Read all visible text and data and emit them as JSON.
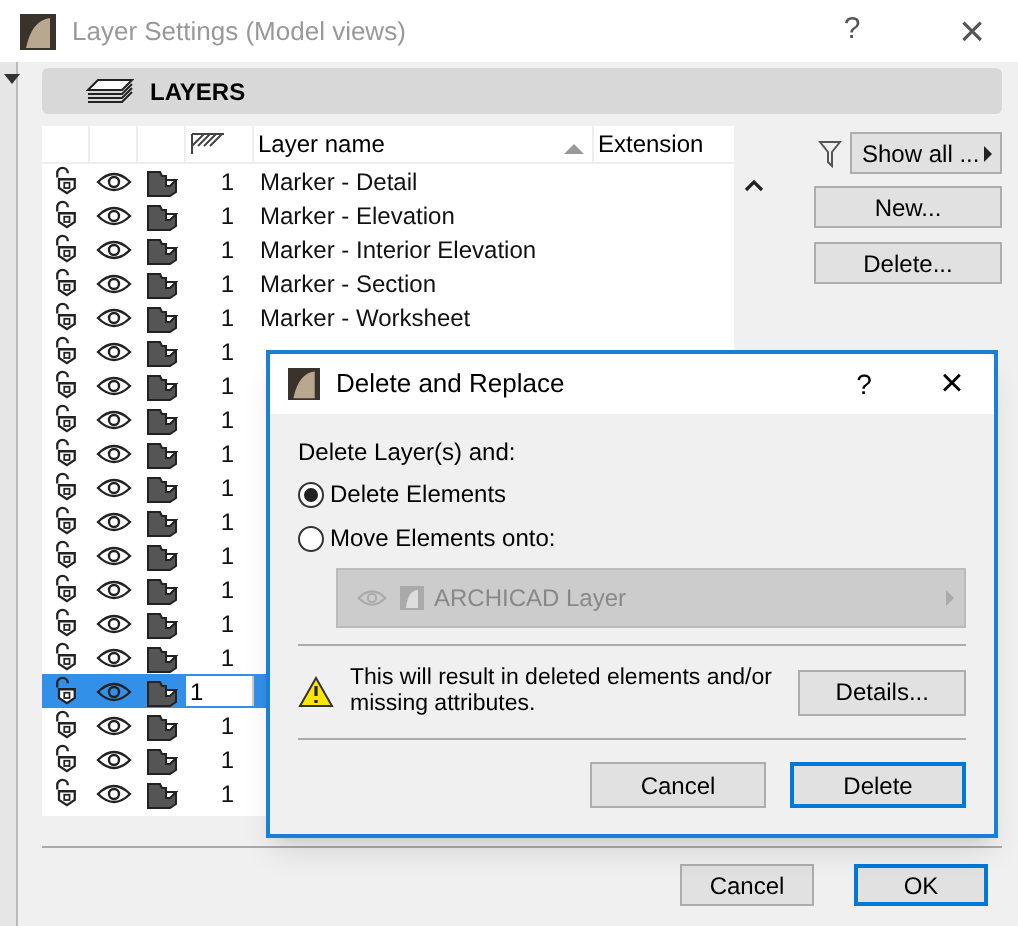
{
  "window": {
    "title": "Layer Settings (Model views)",
    "help": "?",
    "close": "×"
  },
  "section": {
    "label": "LAYERS"
  },
  "table": {
    "columns": [
      "Layer name",
      "Extension"
    ],
    "rows": [
      {
        "number": "1",
        "name": "Marker - Detail",
        "selected": false
      },
      {
        "number": "1",
        "name": "Marker - Elevation",
        "selected": false
      },
      {
        "number": "1",
        "name": "Marker - Interior Elevation",
        "selected": false
      },
      {
        "number": "1",
        "name": "Marker - Section",
        "selected": false
      },
      {
        "number": "1",
        "name": "Marker - Worksheet",
        "selected": false
      },
      {
        "number": "1",
        "selected": false
      },
      {
        "number": "1",
        "selected": false
      },
      {
        "number": "1",
        "selected": false
      },
      {
        "number": "1",
        "selected": false
      },
      {
        "number": "1",
        "selected": false
      },
      {
        "number": "1",
        "selected": false
      },
      {
        "number": "1",
        "selected": false
      },
      {
        "number": "1",
        "selected": false
      },
      {
        "number": "1",
        "selected": false
      },
      {
        "number": "1",
        "selected": false
      },
      {
        "number": "1",
        "selected": true
      },
      {
        "number": "1",
        "selected": false
      },
      {
        "number": "1",
        "selected": false
      },
      {
        "number": "1",
        "selected": false
      }
    ]
  },
  "filter": {
    "label": "Show all ..."
  },
  "side_buttons": [
    "New...",
    "Delete..."
  ],
  "footer_buttons": [
    {
      "label": "Cancel",
      "default": false
    },
    {
      "label": "OK",
      "default": true
    }
  ],
  "dialog": {
    "title": "Delete and Replace",
    "help": "?",
    "close": "×",
    "prompt": "Delete Layer(s) and:",
    "options": [
      {
        "label": "Delete Elements",
        "selected": true
      },
      {
        "label": "Move Elements onto:",
        "selected": false
      }
    ],
    "target": {
      "label": "ARCHICAD Layer",
      "disabled": true
    },
    "warning": "This will result in deleted elements and/or missing attributes.",
    "details_button": "Details...",
    "buttons": [
      {
        "label": "Cancel",
        "default": false
      },
      {
        "label": "Delete",
        "default": true
      }
    ]
  }
}
